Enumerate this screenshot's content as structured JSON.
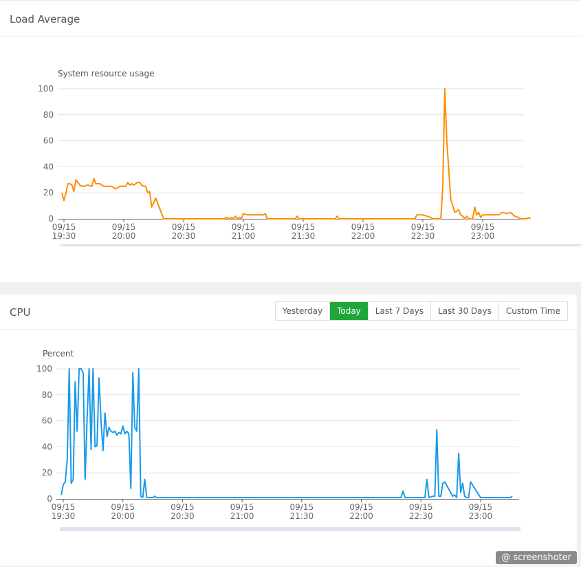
{
  "load_panel": {
    "title": "Load Average"
  },
  "cpu_panel": {
    "title": "CPU",
    "range_buttons": [
      {
        "label": "Yesterday",
        "active": false
      },
      {
        "label": "Today",
        "active": true
      },
      {
        "label": "Last 7 Days",
        "active": false
      },
      {
        "label": "Last 30 Days",
        "active": false
      },
      {
        "label": "Custom Time",
        "active": false
      }
    ]
  },
  "watermark": "@ screenshoter",
  "colors": {
    "load_line": "#ff8c00",
    "cpu_line": "#1a9ae6",
    "active_button": "#20a53a",
    "grid": "#e0e0e0",
    "slider_fill": "#e3ebfb"
  },
  "chart_data": [
    {
      "type": "line",
      "title": "Load Average",
      "ylabel": "System resource usage",
      "xlabel": "",
      "ylim": [
        0,
        100
      ],
      "yticks": [
        "0",
        "20",
        "40",
        "60",
        "80",
        "100"
      ],
      "xticks": [
        {
          "date": "09/15",
          "time": "19:30"
        },
        {
          "date": "09/15",
          "time": "20:00"
        },
        {
          "date": "09/15",
          "time": "20:30"
        },
        {
          "date": "09/15",
          "time": "21:00"
        },
        {
          "date": "09/15",
          "time": "21:30"
        },
        {
          "date": "09/15",
          "time": "22:00"
        },
        {
          "date": "09/15",
          "time": "22:30"
        },
        {
          "date": "09/15",
          "time": "23:00"
        }
      ],
      "grid": true,
      "x_minutes_from_1930": [
        -1,
        0,
        1,
        2,
        3,
        4,
        5,
        6,
        7,
        8,
        9,
        10,
        12,
        14,
        15,
        16,
        18,
        20,
        22,
        24,
        26,
        28,
        29,
        30,
        31,
        32,
        33,
        34,
        35,
        36,
        37,
        38,
        39,
        40,
        41,
        42,
        43,
        44,
        46,
        50,
        60,
        80,
        82,
        83,
        84,
        85,
        86,
        87,
        88,
        89,
        90,
        92,
        96,
        100,
        101,
        102,
        104,
        116,
        117,
        118,
        136,
        137,
        138,
        176,
        177,
        180,
        184,
        185,
        188,
        189,
        190,
        191,
        192,
        194,
        196,
        198,
        199,
        200,
        201,
        202,
        203,
        204,
        205,
        206,
        207,
        208,
        209,
        210,
        211,
        212,
        213,
        214,
        215,
        216,
        218,
        220,
        222,
        224,
        226,
        228,
        229,
        230,
        231,
        232,
        233,
        234
      ],
      "values": [
        20,
        14,
        20,
        27,
        27,
        26,
        21,
        30,
        28,
        26,
        25,
        25,
        26,
        25,
        31,
        27,
        27,
        25,
        25,
        25,
        23,
        25,
        25,
        25,
        25,
        28,
        26,
        27,
        26,
        27,
        28,
        28,
        26,
        25,
        25,
        20,
        21,
        9,
        16,
        0,
        0,
        0,
        1,
        0,
        1,
        0,
        2,
        0,
        1,
        0,
        4,
        3,
        3,
        3,
        4,
        0,
        0,
        0,
        2,
        0,
        0,
        2,
        0,
        0,
        3,
        3,
        1,
        0,
        0,
        0,
        25,
        100,
        60,
        15,
        5,
        7,
        3,
        2,
        0,
        2,
        0,
        0,
        0,
        9,
        3,
        5,
        1,
        3,
        3,
        3,
        3,
        3,
        3,
        3,
        3,
        5,
        4,
        5,
        2,
        1,
        0,
        0,
        0,
        0,
        1,
        0
      ]
    },
    {
      "type": "line",
      "title": "CPU",
      "ylabel": "Percent",
      "xlabel": "",
      "ylim": [
        0,
        100
      ],
      "yticks": [
        "0",
        "20",
        "40",
        "60",
        "80",
        "100"
      ],
      "xticks": [
        {
          "date": "09/15",
          "time": "19:30"
        },
        {
          "date": "09/15",
          "time": "20:00"
        },
        {
          "date": "09/15",
          "time": "20:30"
        },
        {
          "date": "09/15",
          "time": "21:00"
        },
        {
          "date": "09/15",
          "time": "21:30"
        },
        {
          "date": "09/15",
          "time": "22:00"
        },
        {
          "date": "09/15",
          "time": "22:30"
        },
        {
          "date": "09/15",
          "time": "23:00"
        }
      ],
      "grid": true,
      "x_minutes_from_1930": [
        -1,
        0,
        1,
        2,
        3,
        4,
        5,
        6,
        7,
        8,
        9,
        10,
        11,
        12,
        13,
        14,
        15,
        16,
        17,
        18,
        19,
        20,
        21,
        22,
        23,
        24,
        25,
        26,
        27,
        28,
        29,
        30,
        31,
        32,
        33,
        34,
        35,
        36,
        37,
        38,
        39,
        40,
        41,
        42,
        43,
        44,
        45,
        46,
        47,
        50,
        60,
        80,
        90,
        100,
        120,
        140,
        160,
        170,
        171,
        172,
        180,
        182,
        183,
        184,
        186,
        187,
        188,
        189,
        190,
        191,
        192,
        196,
        197,
        198,
        199,
        200,
        201,
        202,
        203,
        204,
        205,
        210,
        211,
        212,
        225,
        226
      ],
      "values": [
        3,
        11,
        13,
        30,
        100,
        12,
        15,
        90,
        52,
        100,
        100,
        97,
        15,
        62,
        100,
        38,
        100,
        40,
        41,
        93,
        60,
        37,
        66,
        48,
        55,
        52,
        51,
        52,
        49,
        51,
        50,
        56,
        50,
        52,
        50,
        8,
        97,
        55,
        52,
        100,
        2,
        1,
        15,
        1,
        1,
        1,
        1,
        2,
        1,
        1,
        1,
        1,
        1,
        1,
        1,
        1,
        1,
        1,
        6,
        1,
        1,
        1,
        15,
        1,
        2,
        2,
        53,
        2,
        2,
        12,
        13,
        2,
        3,
        1,
        35,
        5,
        12,
        2,
        1,
        1,
        13,
        1,
        1,
        1,
        1,
        2
      ]
    }
  ]
}
